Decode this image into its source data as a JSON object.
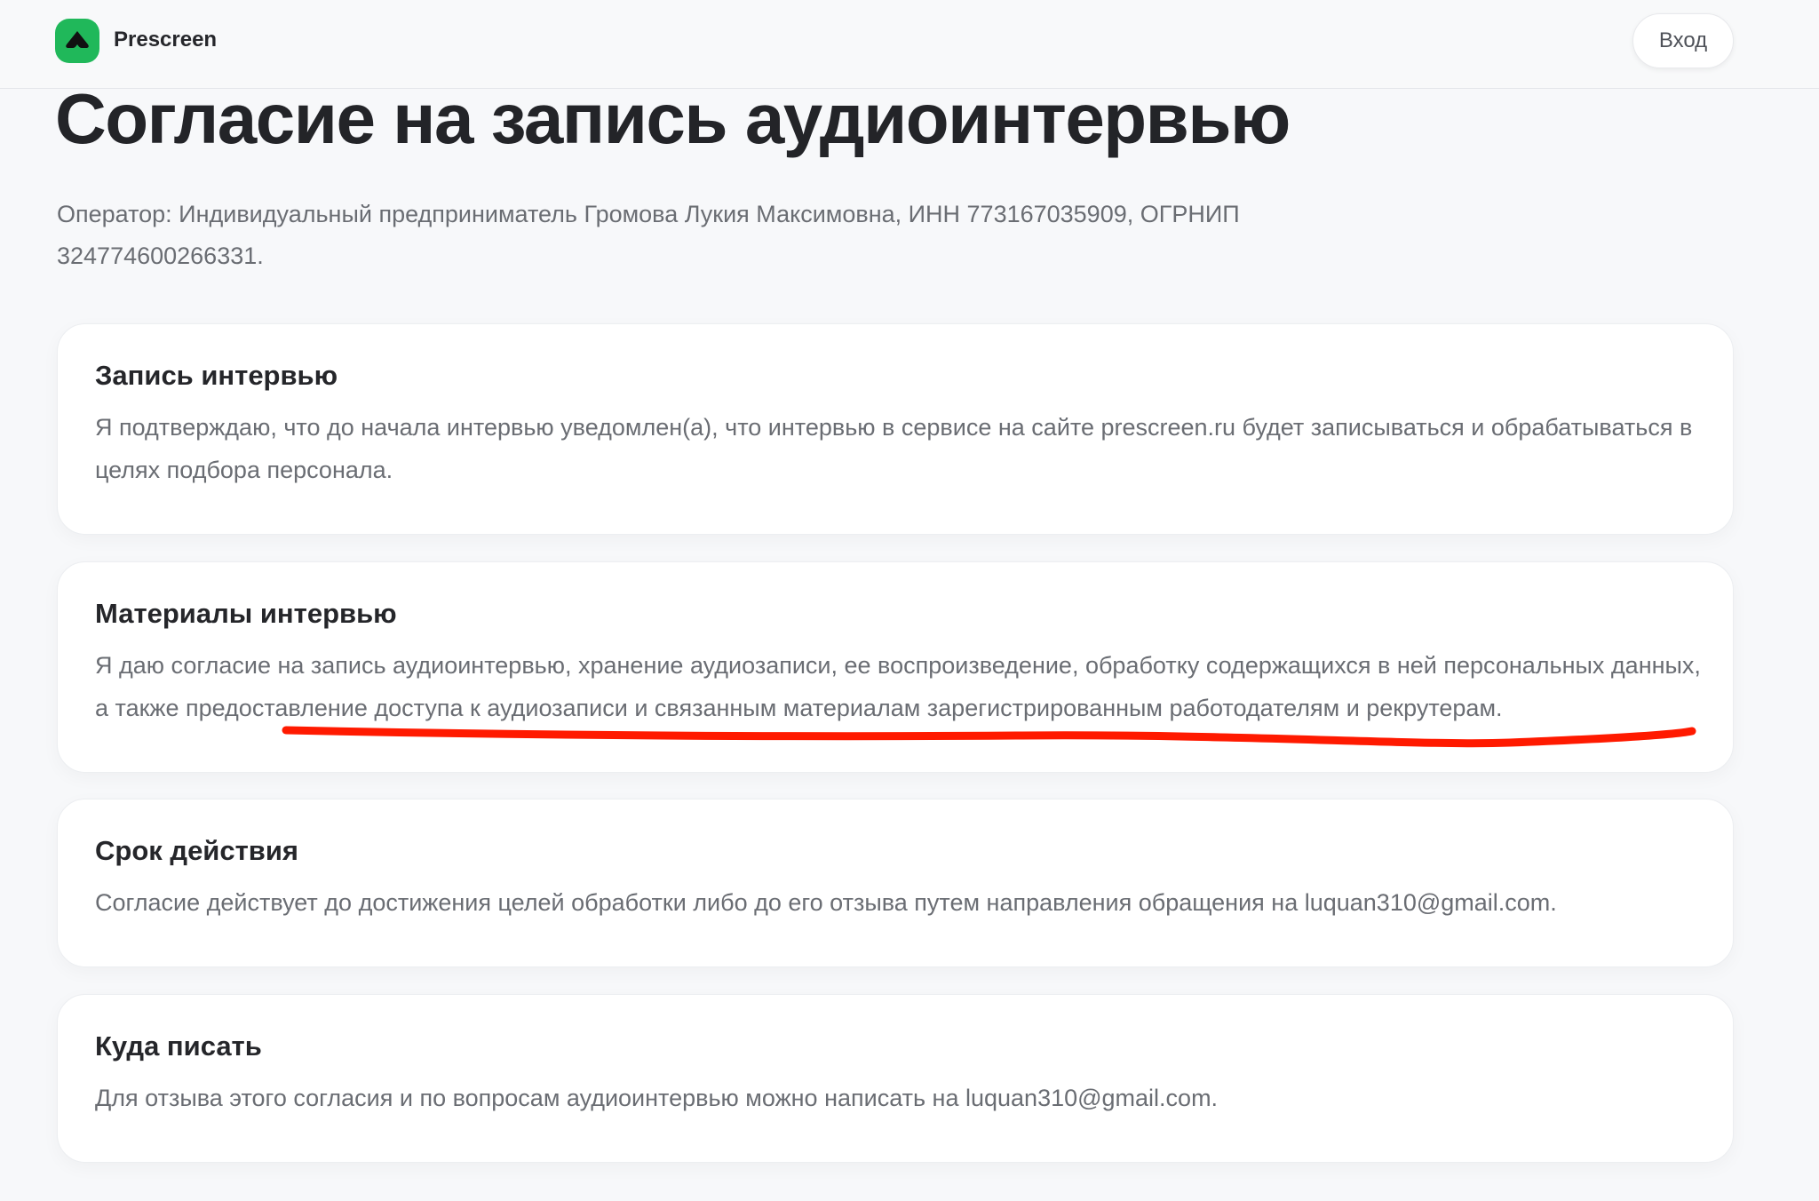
{
  "header": {
    "brand": "Prescreen",
    "login_label": "Вход"
  },
  "main": {
    "title": "Согласие на запись аудиоинтервью",
    "operator_text": "Оператор: Индивидуальный предприниматель Громова Лукия Максимовна, ИНН 773167035909, ОГРНИП 324774600266331."
  },
  "cards": [
    {
      "title": "Запись интервью",
      "text": "Я подтверждаю, что до начала интервью уведомлен(а), что интервью в сервисе на сайте prescreen.ru будет записываться и обрабатываться в целях подбора персонала."
    },
    {
      "title": "Материалы интервью",
      "text": "Я даю согласие на запись аудиоинтервью, хранение аудиозаписи, ее воспроизведение, обработку содержащихся в ней персональных данных, а также предоставление доступа к аудиозаписи и связанным материалам зарегистрированным работодателям и рекрутерам."
    },
    {
      "title": "Срок действия",
      "text": "Согласие действует до достижения целей обработки либо до его отзыва путем направления обращения на luquan310@gmail.com."
    },
    {
      "title": "Куда писать",
      "text": "Для отзыва этого согласия и по вопросам аудиоинтервью можно написать на luquan310@gmail.com."
    }
  ],
  "colors": {
    "brand_green": "#20b85a",
    "annotation_red": "#ff1a00"
  },
  "icons": {
    "logo": "up-chevron-logo-icon"
  }
}
